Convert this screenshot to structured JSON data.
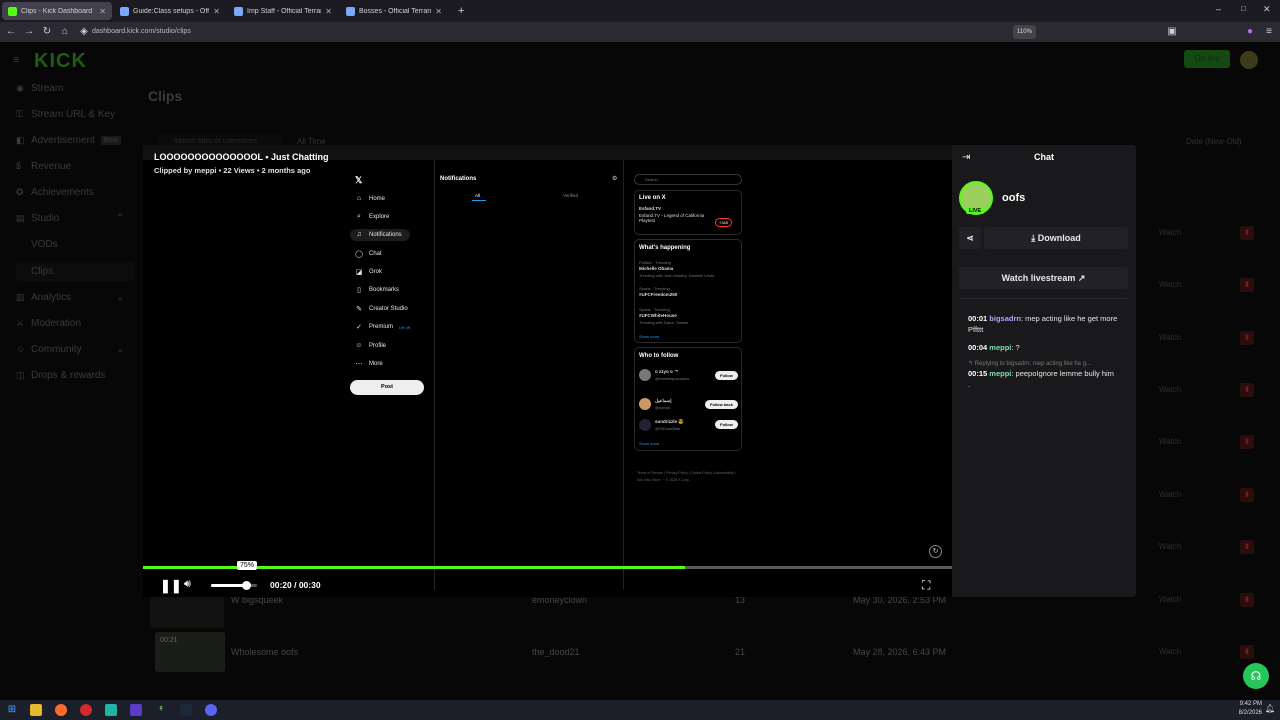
{
  "browser": {
    "tabs": [
      {
        "label": "Clips - Kick Dashboard",
        "icon_color": "#53fc18"
      },
      {
        "label": "Guide:Class setups - Official Ter",
        "icon_color": "#7aa7ff"
      },
      {
        "label": "Imp Staff - Official Terraria Wiki",
        "icon_color": "#7aa7ff"
      },
      {
        "label": "Bosses - Official Terraria Wiki",
        "icon_color": "#7aa7ff"
      }
    ],
    "url": "dashboard.kick.com/studio/clips",
    "zoom": "110%"
  },
  "kick": {
    "logo": "KICK",
    "go_live": "Go live",
    "page_title": "Clips",
    "sidebar": [
      {
        "label": "Stream",
        "icon": "broadcast-icon"
      },
      {
        "label": "Stream URL & Key",
        "icon": "key-icon"
      },
      {
        "label": "Advertisement",
        "badge": "Beta",
        "icon": "megaphone-icon"
      },
      {
        "label": "Revenue",
        "icon": "dollar-icon"
      },
      {
        "label": "Achievements",
        "icon": "trophy-icon"
      },
      {
        "label": "Studio",
        "icon": "studio-icon"
      },
      {
        "label": "VODs",
        "icon": ""
      },
      {
        "label": "Clips",
        "icon": ""
      },
      {
        "label": "Analytics",
        "icon": "chart-icon"
      },
      {
        "label": "Moderation",
        "icon": "sword-icon"
      },
      {
        "label": "Community",
        "icon": "users-icon"
      },
      {
        "label": "Drops & rewards",
        "icon": "gift-icon"
      }
    ],
    "search_placeholder": "Search titles or usernames",
    "time_filter": "All Time",
    "sort": "Date (New-Old)",
    "row_action": "Watch",
    "rows": [
      {
        "title": "W bigsqueek",
        "channel": "emoneyclown",
        "views": "13",
        "date": "May 30, 2026, 2:53 PM"
      },
      {
        "title": "Wholesome oofs",
        "channel": "the_dood21",
        "views": "21",
        "date": "May 28, 2026, 6:43 PM",
        "duration": "00:21"
      }
    ]
  },
  "player": {
    "title": "LOOOOOOOOOOOOOOL • Just Chatting",
    "subtitle": "Clipped by meppi • 22 Views • 2 months ago",
    "time": "00:20 / 00:30",
    "volume": "75%",
    "progress": 0.67,
    "volume_level": 0.75
  },
  "xapp": {
    "nav": [
      "Home",
      "Explore",
      "Notifications",
      "Chat",
      "Grok",
      "Bookmarks",
      "Creator Studio",
      "Premium",
      "Profile",
      "More"
    ],
    "premium_badge": "Lift off",
    "post": "Post",
    "notif_title": "Notifications",
    "tabs": [
      "All",
      "Verified"
    ],
    "search": "Search",
    "live_title": "Live on X",
    "live_host": "Esfand.TV",
    "live_desc": "Esfand.TV - Legend of California Playtest",
    "live_count": "+345",
    "happening_title": "What's happening",
    "trends": [
      {
        "cat": "Politics · Trending",
        "name": "Michelle Obama",
        "sub": "Trending with Josh Hawley, Danielle Lewis"
      },
      {
        "cat": "Sports · Trending",
        "name": "#UFCFreedom250",
        "sub": ""
      },
      {
        "cat": "Sports · Trending",
        "name": "#UFCWhiteHouse",
        "sub": "Trending with Dana, Tweets"
      }
    ],
    "show_more": "Show more",
    "who_title": "Who to follow",
    "follows": [
      {
        "name": "o zzyo o ™",
        "handle": "@marketspaceplus",
        "btn": "Follow"
      },
      {
        "name": "إسماعيل",
        "handle": "@Ismail...",
        "btn": "Follow back"
      },
      {
        "name": "sundrizzle 😎",
        "handle": "@SlGoneBlah",
        "btn": "Follow"
      }
    ],
    "footer": "Terms of Service | Privacy Policy | Cookie Policy | Accessibility | Ads info | More ··· © 2026 X Corp."
  },
  "chat": {
    "title": "Chat",
    "channel": "oofs",
    "live_badge": "LIVE",
    "download": "Download",
    "watch_livestream": "Watch livestream",
    "messages": [
      {
        "ts": "00:01",
        "user": "bigsadrn",
        "text": "mep acting like he get more Pffttt",
        "reply": ""
      },
      {
        "ts": "00:04",
        "user": "meppi",
        "text": "?",
        "reply": ""
      },
      {
        "ts": "00:15",
        "user": "meppi",
        "text": "peepoIgnore lemme bully him .",
        "reply": "Replying to bigsadrn: mep acting like he g..."
      }
    ]
  },
  "system": {
    "clock": "9:42 PM",
    "date": "8/2/2026"
  }
}
